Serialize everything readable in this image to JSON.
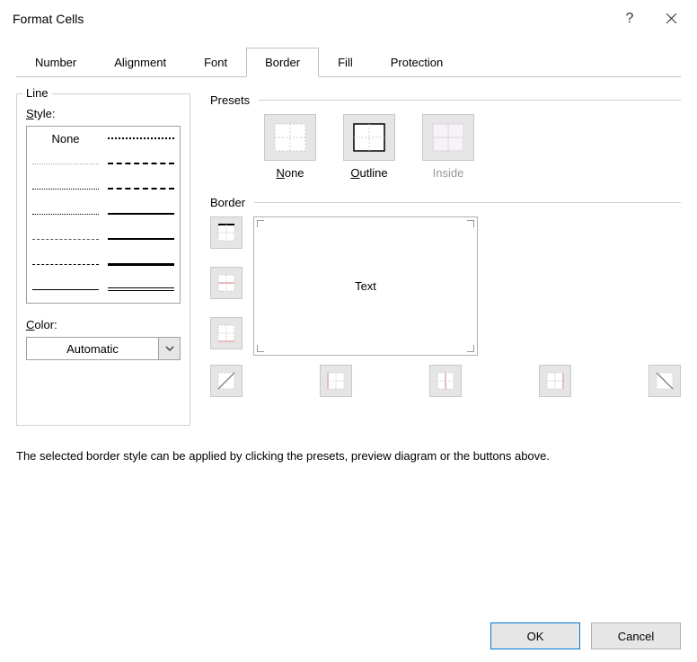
{
  "window": {
    "title": "Format Cells"
  },
  "tabs": [
    "Number",
    "Alignment",
    "Font",
    "Border",
    "Fill",
    "Protection"
  ],
  "active_tab": "Border",
  "line": {
    "group": "Line",
    "style_label": "Style:",
    "none_label": "None",
    "color_label": "Color:",
    "color_value": "Automatic"
  },
  "presets": {
    "group": "Presets",
    "items": [
      {
        "label_pre": "",
        "ul": "N",
        "label_post": "one",
        "enabled": true
      },
      {
        "label_pre": "",
        "ul": "O",
        "label_post": "utline",
        "enabled": true
      },
      {
        "label_pre": "",
        "ul": "I",
        "label_post": "nside",
        "enabled": false
      }
    ]
  },
  "border": {
    "group": "Border",
    "preview_text": "Text"
  },
  "info": "The selected border style can be applied by clicking the presets, preview diagram or the buttons above.",
  "buttons": {
    "ok": "OK",
    "cancel": "Cancel"
  }
}
